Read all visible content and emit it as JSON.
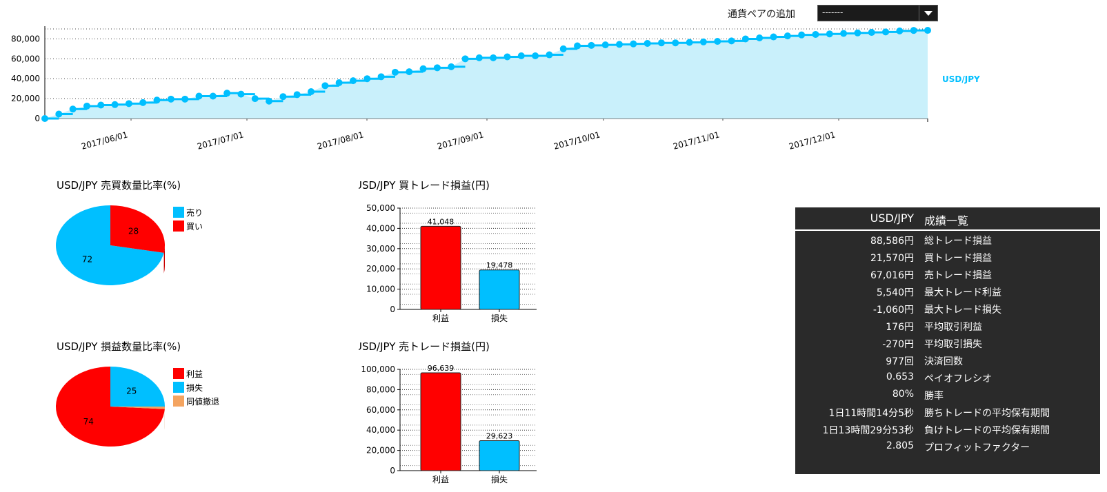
{
  "header": {
    "pair_label": "通貨ペアの追加",
    "pair_select_value": "-------"
  },
  "colors": {
    "blue": "#00bfff",
    "red": "#ff0000",
    "orange": "#f4a460",
    "dark": "#2a2a2a",
    "area": "#c9f0fb"
  },
  "icons": [
    "chevron-down-icon"
  ],
  "chart_data": [
    {
      "type": "area",
      "series": [
        {
          "name": "USD/JPY",
          "values": [
            0,
            4500,
            9500,
            12500,
            13500,
            14000,
            15000,
            16000,
            18500,
            19500,
            19500,
            22500,
            22500,
            25500,
            24500,
            20000,
            17500,
            22000,
            24000,
            27000,
            33000,
            36000,
            38000,
            40000,
            42000,
            46500,
            47000,
            50000,
            51000,
            52000,
            60000,
            61000,
            61000,
            62000,
            63000,
            63000,
            64000,
            70000,
            73000,
            73500,
            74000,
            74500,
            75000,
            75500,
            76000,
            76000,
            76500,
            77000,
            77500,
            78000,
            80000,
            81000,
            82000,
            83000,
            84000,
            84500,
            85000,
            85500,
            86000,
            86500,
            87000,
            88000,
            88500,
            88586
          ]
        }
      ],
      "ylim": [
        0,
        90000
      ],
      "yticks": [
        "0",
        "20,000",
        "40,000",
        "60,000",
        "80,000"
      ],
      "xticks": [
        "2017/06/01",
        "2017/07/01",
        "2017/08/01",
        "2017/09/01",
        "2017/10/01",
        "2017/11/01",
        "2017/12/01"
      ],
      "grid": true,
      "legend": "right"
    },
    {
      "type": "pie",
      "title": "USD/JPY 売買数量比率(%)",
      "slices": [
        {
          "label": "売り",
          "value": 72,
          "color": "#00bfff"
        },
        {
          "label": "買い",
          "value": 28,
          "color": "#ff0000"
        }
      ]
    },
    {
      "type": "pie",
      "title": "USD/JPY 損益数量比率(%)",
      "slices": [
        {
          "label": "利益",
          "value": 74,
          "color": "#ff0000"
        },
        {
          "label": "損失",
          "value": 25,
          "color": "#00bfff"
        },
        {
          "label": "同値撤退",
          "value": 1,
          "color": "#f4a460"
        }
      ]
    },
    {
      "type": "bar",
      "title": "USD/JPY 買トレード損益(円)",
      "categories": [
        "利益",
        "損失"
      ],
      "values": [
        41048,
        19478
      ],
      "value_labels": [
        "41,048",
        "19,478"
      ],
      "ylim": [
        0,
        50000
      ],
      "yticks": [
        "0",
        "10,000",
        "20,000",
        "30,000",
        "40,000",
        "50,000"
      ]
    },
    {
      "type": "bar",
      "title": "USD/JPY 売トレード損益(円)",
      "categories": [
        "利益",
        "損失"
      ],
      "values": [
        96639,
        29623
      ],
      "value_labels": [
        "96,639",
        "29,623"
      ],
      "ylim": [
        0,
        100000
      ],
      "yticks": [
        "0",
        "20,000",
        "40,000",
        "60,000",
        "80,000",
        "100,000"
      ]
    }
  ],
  "stats": {
    "header_value": "USD/JPY",
    "header_label": "成績一覧",
    "rows": [
      {
        "value": "88,586円",
        "label": "総トレード損益"
      },
      {
        "value": "21,570円",
        "label": "買トレード損益"
      },
      {
        "value": "67,016円",
        "label": "売トレード損益"
      },
      {
        "value": "5,540円",
        "label": "最大トレード利益"
      },
      {
        "value": "-1,060円",
        "label": "最大トレード損失"
      },
      {
        "value": "176円",
        "label": "平均取引利益"
      },
      {
        "value": "-270円",
        "label": "平均取引損失"
      },
      {
        "value": "977回",
        "label": "決済回数"
      },
      {
        "value": "0.653",
        "label": "ペイオフレシオ"
      },
      {
        "value": "80%",
        "label": "勝率"
      },
      {
        "value": "1日11時間14分5秒",
        "label": "勝ちトレードの平均保有期間"
      },
      {
        "value": "1日13時間29分53秒",
        "label": "負けトレードの平均保有期間"
      },
      {
        "value": "2.805",
        "label": "プロフィットファクター"
      }
    ]
  }
}
